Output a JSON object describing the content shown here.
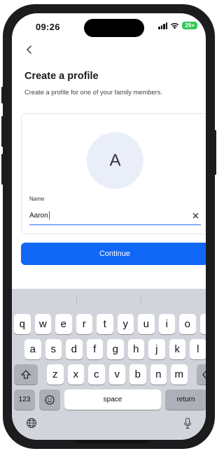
{
  "status": {
    "time": "09:26",
    "battery": "29+"
  },
  "header": {
    "back_icon": "chevron-left-icon",
    "title": "Create a profile",
    "subtitle": "Create a profile for one of your family members."
  },
  "profile": {
    "avatar_initial": "A",
    "name_label": "Name",
    "name_value": "Aaron"
  },
  "actions": {
    "continue_label": "Continue"
  },
  "keyboard": {
    "row1": [
      "q",
      "w",
      "e",
      "r",
      "t",
      "y",
      "u",
      "i",
      "o",
      "p"
    ],
    "row2": [
      "a",
      "s",
      "d",
      "f",
      "g",
      "h",
      "j",
      "k",
      "l"
    ],
    "row3": [
      "z",
      "x",
      "c",
      "v",
      "b",
      "n",
      "m"
    ],
    "numbers_label": "123",
    "space_label": "space",
    "return_label": "return"
  },
  "colors": {
    "accent": "#1168f6",
    "keyboard_bg": "#d1d4da"
  }
}
